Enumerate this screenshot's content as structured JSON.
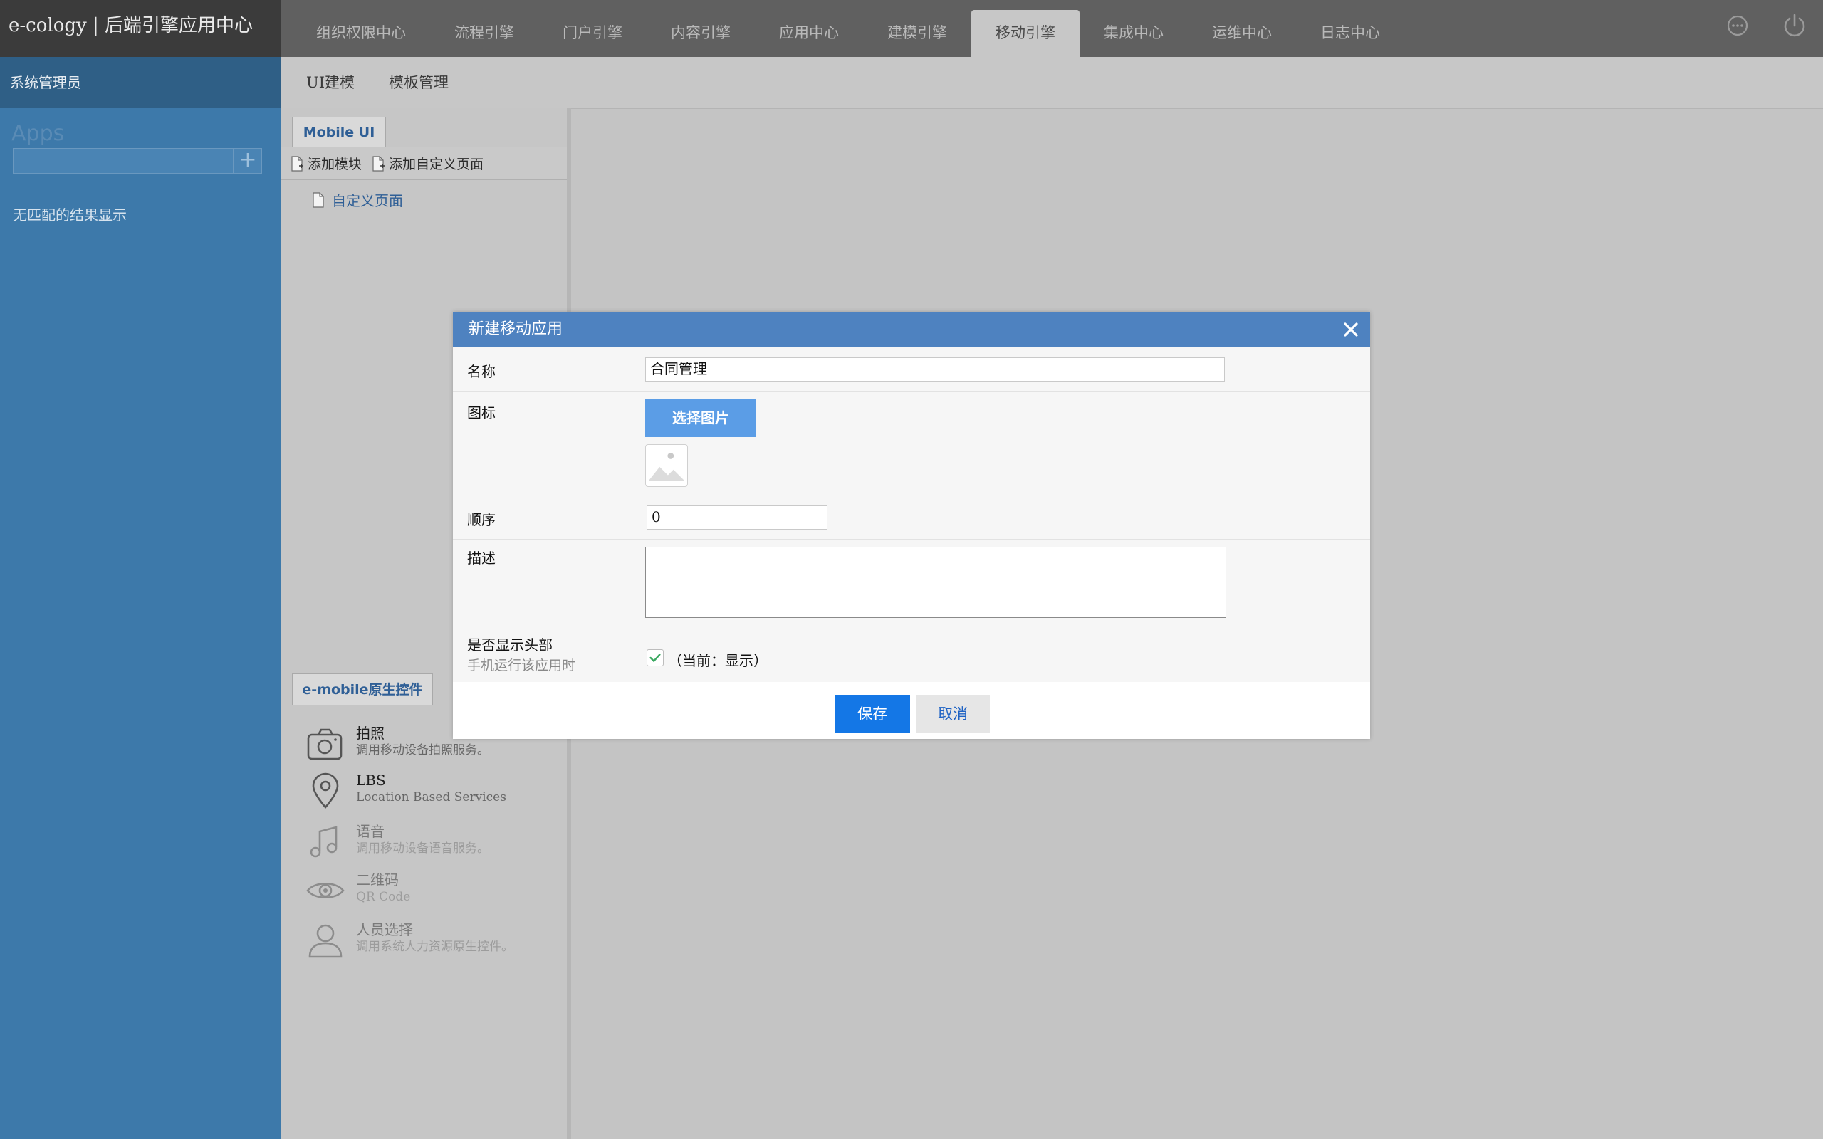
{
  "header": {
    "brand": "e-cology | 后端引擎应用中心",
    "nav": [
      "组织权限中心",
      "流程引擎",
      "门户引擎",
      "内容引擎",
      "应用中心",
      "建模引擎",
      "移动引擎",
      "集成中心",
      "运维中心",
      "日志中心"
    ],
    "active_nav": "移动引擎"
  },
  "subnav": {
    "tabs": [
      "UI建模",
      "模板管理"
    ]
  },
  "sidebar": {
    "user": "系统管理员",
    "apps_label": "Apps",
    "add_label": "+",
    "empty_text": "无匹配的结果显示"
  },
  "panel": {
    "tab": "Mobile UI",
    "toolbar": [
      "添加模块",
      "添加自定义页面"
    ],
    "tree_item": "自定义页面",
    "native_tab": "e-mobile原生控件",
    "native_items": [
      {
        "title": "拍照",
        "desc": "调用移动设备拍照服务。",
        "icon": "camera-icon"
      },
      {
        "title": "LBS",
        "desc": "Location Based Services",
        "icon": "location-pin-icon"
      },
      {
        "title": "语音",
        "desc": "调用移动设备语音服务。",
        "icon": "music-note-icon"
      },
      {
        "title": "二维码",
        "desc": "QR Code",
        "icon": "eye-icon"
      },
      {
        "title": "人员选择",
        "desc": "调用系统人力资源原生控件。",
        "icon": "person-icon"
      }
    ]
  },
  "dialog": {
    "title": "新建移动应用",
    "name_label": "名称",
    "name_value": "合同管理",
    "icon_label": "图标",
    "pick_image": "选择图片",
    "order_label": "顺序",
    "order_value": "0",
    "desc_label": "描述",
    "desc_value": "",
    "header_label": "是否显示头部",
    "header_sublabel": "手机运行该应用时",
    "header_status": "（当前：显示）",
    "save": "保存",
    "cancel": "取消"
  },
  "colors": {
    "top_bar": "#606060",
    "sidebar": "#3d79aa",
    "dialog_header": "#4e82c0",
    "primary_button": "#1477e6",
    "link_text": "#2f5f96"
  }
}
